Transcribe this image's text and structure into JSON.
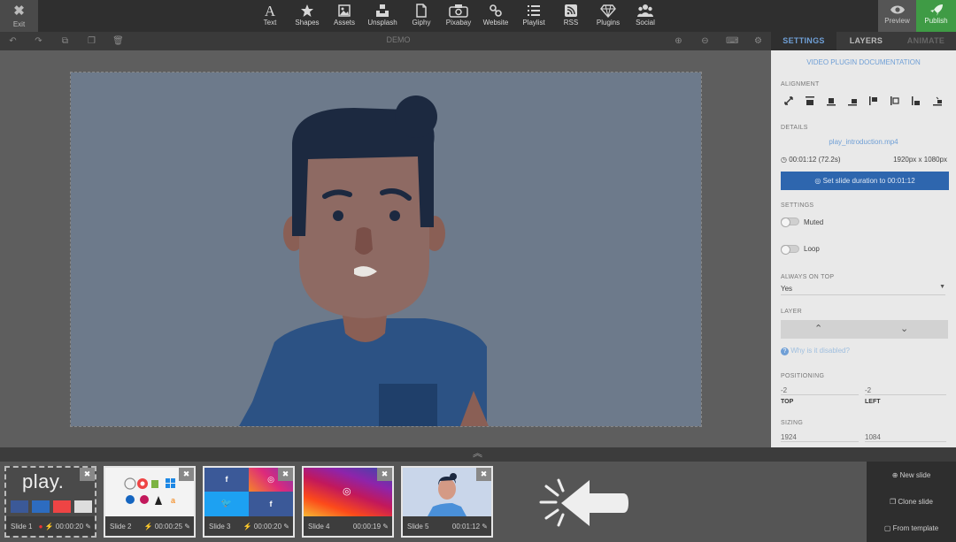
{
  "topbar": {
    "exit": "Exit",
    "tools": [
      "Text",
      "Shapes",
      "Assets",
      "Unsplash",
      "Giphy",
      "Pixabay",
      "Website",
      "Playlist",
      "RSS",
      "Plugins",
      "Social"
    ],
    "preview": "Preview",
    "publish": "Publish"
  },
  "editor": {
    "canvas_name": "DEMO"
  },
  "panel": {
    "tabs": [
      "SETTINGS",
      "LAYERS",
      "ANIMATE"
    ],
    "doc_link": "VIDEO PLUGIN DOCUMENTATION",
    "alignment_label": "ALIGNMENT",
    "details_label": "DETAILS",
    "file_name": "play_introduction.mp4",
    "duration": "00:01:12 (72.2s)",
    "resolution": "1920px x 1080px",
    "set_duration_button": "Set slide duration to 00:01:12",
    "settings_label": "SETTINGS",
    "muted_label": "Muted",
    "loop_label": "Loop",
    "always_on_top_label": "ALWAYS ON TOP",
    "always_on_top_value": "Yes",
    "layer_label": "LAYER",
    "why_disabled": "Why is it disabled?",
    "positioning_label": "POSITIONING",
    "top_value": "-2",
    "left_value": "-2",
    "top_label": "TOP",
    "left_label": "LEFT",
    "sizing_label": "SIZING",
    "width_value": "1924",
    "height_value": "1084"
  },
  "slides": [
    {
      "name": "Slide 1",
      "duration": "00:00:20",
      "live": true
    },
    {
      "name": "Slide 2",
      "duration": "00:00:25",
      "live": false
    },
    {
      "name": "Slide 3",
      "duration": "00:00:20",
      "live": false
    },
    {
      "name": "Slide 4",
      "duration": "00:00:19",
      "live": false
    },
    {
      "name": "Slide 5",
      "duration": "00:01:12",
      "live": false
    }
  ],
  "slide1_logo": "play.",
  "slide_actions": {
    "new_slide": "New slide",
    "clone_slide": "Clone slide",
    "from_template": "From template"
  },
  "colors": {
    "publish": "#3f9b45",
    "primary_button": "#2e66ae",
    "stage_bg": "#6d7a8b",
    "link": "#6f9fd6"
  }
}
